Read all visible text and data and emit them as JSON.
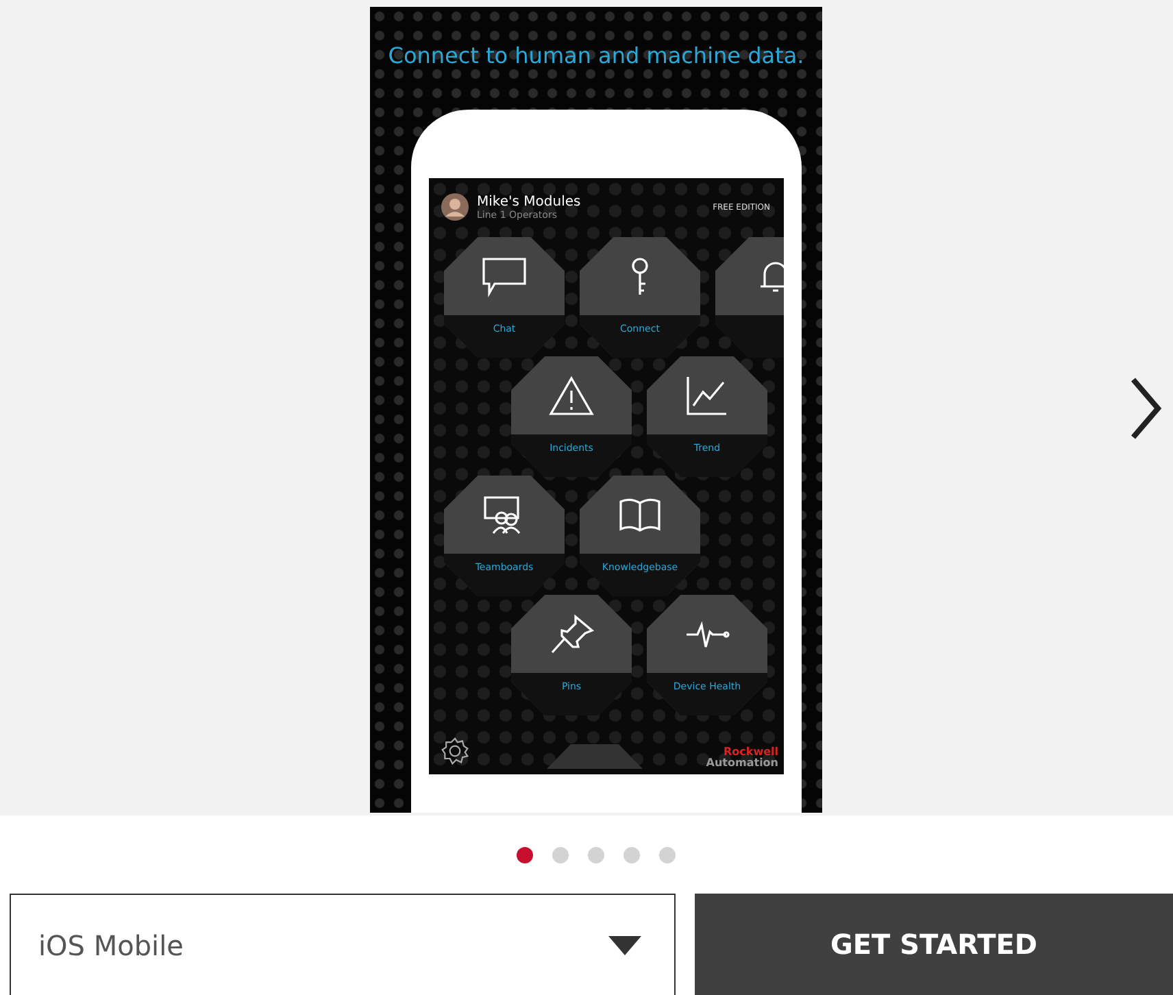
{
  "carousel": {
    "caption": "Connect to human and machine data.",
    "phone": {
      "user": "Mike's Modules",
      "role": "Line 1 Operators",
      "edition": "FREE EDITION",
      "rows": [
        {
          "tiles": [
            {
              "label": "Chat",
              "kind": "chat"
            },
            {
              "label": "Connect",
              "kind": "key"
            },
            {
              "kind": "bell"
            }
          ]
        },
        {
          "tiles": [
            {
              "label": "Incidents",
              "kind": "warning"
            },
            {
              "label": "Trend",
              "kind": "chart"
            }
          ]
        },
        {
          "tiles": [
            {
              "label": "Teamboards",
              "kind": "team"
            },
            {
              "label": "Knowledgebase",
              "kind": "book"
            }
          ]
        },
        {
          "tiles": [
            {
              "label": "Pins",
              "kind": "pin"
            },
            {
              "label": "Device Health",
              "kind": "pulse"
            }
          ]
        }
      ],
      "brand": [
        "Rockwell",
        "Automation"
      ]
    }
  },
  "dots": [
    {
      "selected": true
    },
    {
      "selected": false
    },
    {
      "selected": false
    },
    {
      "selected": false
    },
    {
      "selected": false
    }
  ],
  "platform": {
    "value": "iOS Mobile"
  },
  "button": "GET STARTED"
}
